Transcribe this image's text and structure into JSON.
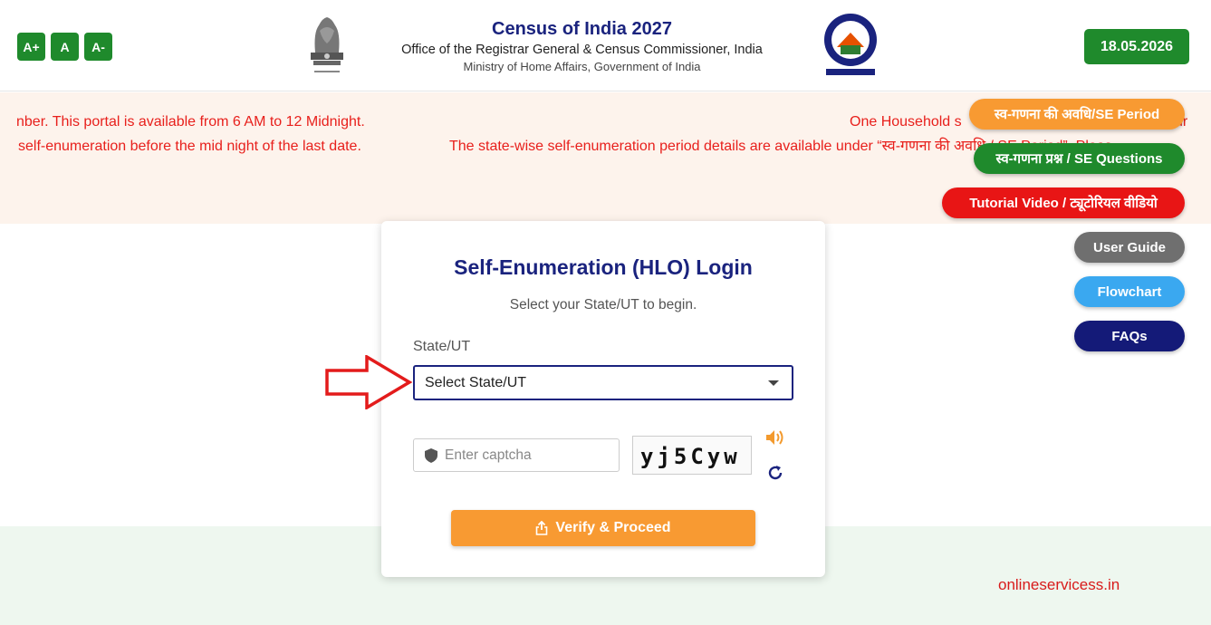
{
  "header": {
    "font_controls": [
      "A+",
      "A",
      "A-"
    ],
    "title": "Census of India 2027",
    "subtitle": "Office of the Registrar General & Census Commissioner, India",
    "ministry": "Ministry of Home Affairs, Government of India",
    "date": "18.05.2026"
  },
  "announcements": {
    "line1_left": "nber. This portal is available from 6 AM to 12 Midnight.",
    "line1_right": "One Household s",
    "line1_tail": "ur",
    "line2_left": "self-enumeration before the mid night of the last date.",
    "line2_right": "The state-wise self-enumeration period details are available under “स्व-गणना की अवधि / SE Period”. Pleas"
  },
  "side_buttons": {
    "se_period": "स्व-गणना की अवधि/SE Period",
    "se_questions": "स्व-गणना प्रश्न / SE Questions",
    "tutorial": "Tutorial Video / ट्यूटोरियल वीडियो",
    "user_guide": "User Guide",
    "flowchart": "Flowchart",
    "faqs": "FAQs"
  },
  "login": {
    "title": "Self-Enumeration (HLO) Login",
    "subtitle": "Select your State/UT to begin.",
    "state_label": "State/UT",
    "state_selected": "Select State/UT",
    "captcha_placeholder": "Enter captcha",
    "captcha_code": "yj5Cyw",
    "verify_label": "Verify & Proceed"
  },
  "watermark": "onlineservicess.in",
  "colors": {
    "green": "#1f8a2c",
    "navy": "#1a237e",
    "orange": "#f89a32",
    "red": "#e8201c"
  }
}
